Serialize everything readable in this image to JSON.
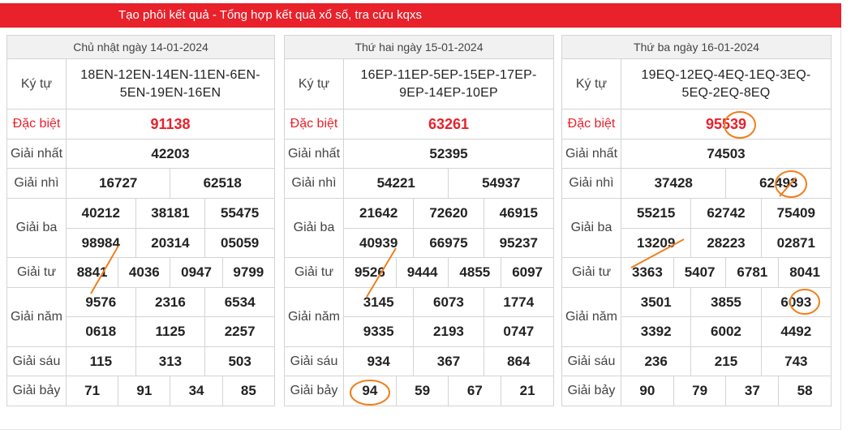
{
  "banner": {
    "title": "Tạo phôi kết quả - Tổng hợp kết quả xổ số, tra cứu kqxs"
  },
  "labels": {
    "kytu": "Ký tự",
    "dacbiet": "Đặc biệt",
    "nhat": "Giải nhất",
    "nhi": "Giải nhì",
    "ba": "Giải ba",
    "tu": "Giải tư",
    "nam": "Giải năm",
    "sau": "Giải sáu",
    "bay": "Giải bảy"
  },
  "colors": {
    "banner": "#e8212b",
    "special": "#e8212b",
    "marker": "#f07f1c"
  },
  "tables": [
    {
      "date": "Chủ nhật ngày 14-01-2024",
      "kytu_line1": "18EN-12EN-14EN-11EN-6EN-",
      "kytu_line2": "5EN-19EN-16EN",
      "dacbiet": "91138",
      "nhat": "42203",
      "nhi": [
        "16727",
        "62518"
      ],
      "ba": [
        "40212",
        "38181",
        "55475",
        "98984",
        "20314",
        "05059"
      ],
      "tu": [
        "8841",
        "4036",
        "0947",
        "9799"
      ],
      "nam": [
        "9576",
        "2316",
        "6534",
        "0618",
        "1125",
        "2257"
      ],
      "sau": [
        "115",
        "313",
        "503"
      ],
      "bay": [
        "71",
        "91",
        "34",
        "85"
      ]
    },
    {
      "date": "Thứ hai ngày 15-01-2024",
      "kytu_line1": "16EP-11EP-5EP-15EP-17EP-",
      "kytu_line2": "9EP-14EP-10EP",
      "dacbiet": "63261",
      "nhat": "52395",
      "nhi": [
        "54221",
        "54937"
      ],
      "ba": [
        "21642",
        "72620",
        "46915",
        "40939",
        "66975",
        "95237"
      ],
      "tu": [
        "9526",
        "9444",
        "4855",
        "6097"
      ],
      "nam": [
        "3145",
        "6073",
        "1774",
        "9335",
        "2193",
        "0747"
      ],
      "sau": [
        "934",
        "367",
        "864"
      ],
      "bay": [
        "94",
        "59",
        "67",
        "21"
      ]
    },
    {
      "date": "Thứ ba ngày 16-01-2024",
      "kytu_line1": "19EQ-12EQ-4EQ-1EQ-3EQ-",
      "kytu_line2": "5EQ-2EQ-8EQ",
      "dacbiet": "95539",
      "nhat": "74503",
      "nhi": [
        "37428",
        "62493"
      ],
      "ba": [
        "55215",
        "62742",
        "75409",
        "13209",
        "28223",
        "02871"
      ],
      "tu": [
        "3363",
        "5407",
        "6781",
        "8041"
      ],
      "nam": [
        "3501",
        "3855",
        "6093",
        "3392",
        "6002",
        "4492"
      ],
      "sau": [
        "236",
        "215",
        "743"
      ],
      "bay": [
        "90",
        "79",
        "37",
        "58"
      ]
    }
  ]
}
